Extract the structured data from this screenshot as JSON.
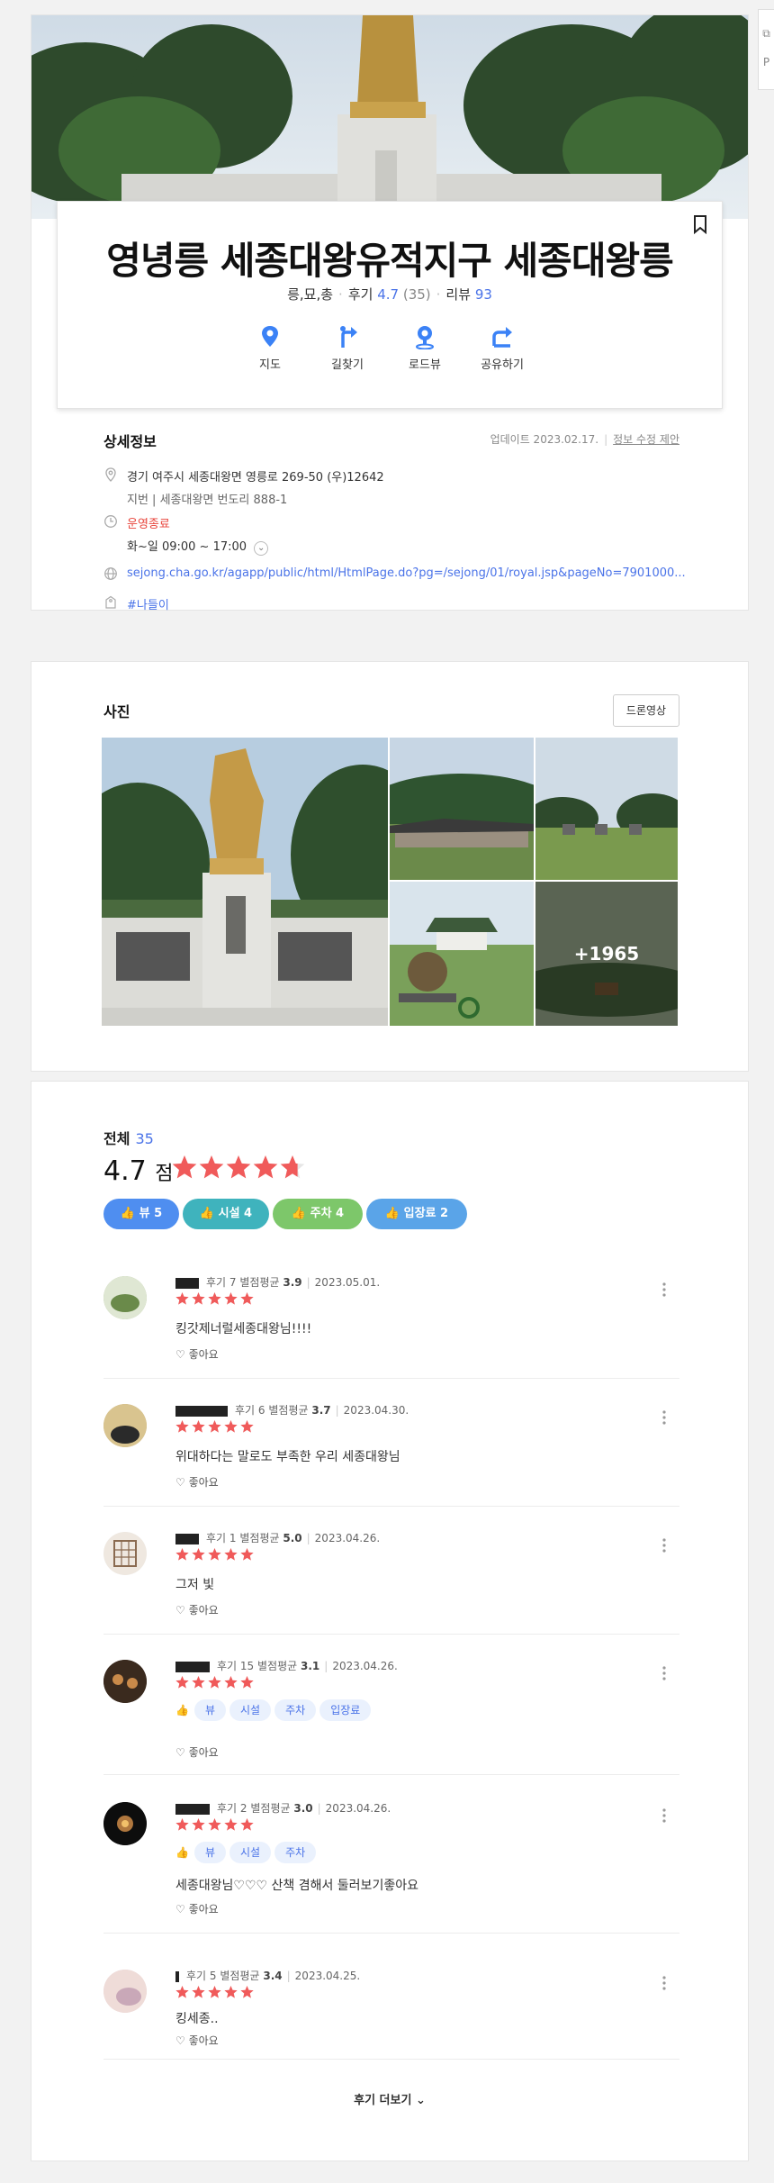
{
  "place": {
    "title": "영녕릉 세종대왕유적지구 세종대왕릉",
    "category": "릉,묘,총",
    "review_label": "후기",
    "rating": "4.7",
    "rating_count": "(35)",
    "blog_label": "리뷰",
    "blog_count": "93"
  },
  "actions": [
    "지도",
    "길찾기",
    "로드뷰",
    "공유하기"
  ],
  "details": {
    "section_title": "상세정보",
    "updated": "업데이트 2023.02.17.",
    "edit_link": "정보 수정 제안",
    "address": "경기 여주시 세종대왕면 영릉로 269-50 (우)12642",
    "jibun_label": "지번",
    "jibun": "세종대왕면 번도리 888-1",
    "status": "운영종료",
    "hours": "화~일  09:00 ~ 17:00",
    "url": "sejong.cha.go.kr/agapp/public/html/HtmlPage.do?pg=/sejong/01/royal.jsp&pageNo=7901000...",
    "tag": "#나들이"
  },
  "photos": {
    "section_title": "사진",
    "drone_button": "드론영상",
    "more_count": "+1965"
  },
  "reviews_summary": {
    "total_label": "전체",
    "total_count": "35",
    "score": "4.7",
    "score_unit": "점",
    "score_value": 4.7,
    "keywords": [
      {
        "label": "뷰 5",
        "color": "#4f8ef0"
      },
      {
        "label": "시설 4",
        "color": "#3fb3bd"
      },
      {
        "label": "주차 4",
        "color": "#7dc76a"
      },
      {
        "label": "입장료 2",
        "color": "#5aa4e8"
      }
    ]
  },
  "reviews": [
    {
      "count_label": "후기 7",
      "avg_label": "별점평균",
      "avg": "3.9",
      "date": "2023.05.01.",
      "text": "킹갓제너럴세종대왕님!!!!",
      "like": "좋아요",
      "tags": []
    },
    {
      "count_label": "후기 6",
      "avg_label": "별점평균",
      "avg": "3.7",
      "date": "2023.04.30.",
      "text": "위대하다는 말로도 부족한 우리 세종대왕님",
      "like": "좋아요",
      "tags": []
    },
    {
      "count_label": "후기 1",
      "avg_label": "별점평균",
      "avg": "5.0",
      "date": "2023.04.26.",
      "text": "그저 빛",
      "like": "좋아요",
      "tags": []
    },
    {
      "count_label": "후기 15",
      "avg_label": "별점평균",
      "avg": "3.1",
      "date": "2023.04.26.",
      "text": "",
      "like": "좋아요",
      "tags": [
        "뷰",
        "시설",
        "주차",
        "입장료"
      ]
    },
    {
      "count_label": "후기 2",
      "avg_label": "별점평균",
      "avg": "3.0",
      "date": "2023.04.26.",
      "text": "세종대왕님♡♡♡ 산책 겸해서 둘러보기좋아요",
      "like": "좋아요",
      "tags": [
        "뷰",
        "시설",
        "주차"
      ]
    },
    {
      "count_label": "후기 5",
      "avg_label": "별점평균",
      "avg": "3.4",
      "date": "2023.04.25.",
      "text": "킹세종..",
      "like": "좋아요",
      "tags": []
    }
  ],
  "load_more": "후기 더보기",
  "colors": {
    "accent": "#4a73e8",
    "star": "#f05a5a",
    "danger": "#e8453c"
  }
}
